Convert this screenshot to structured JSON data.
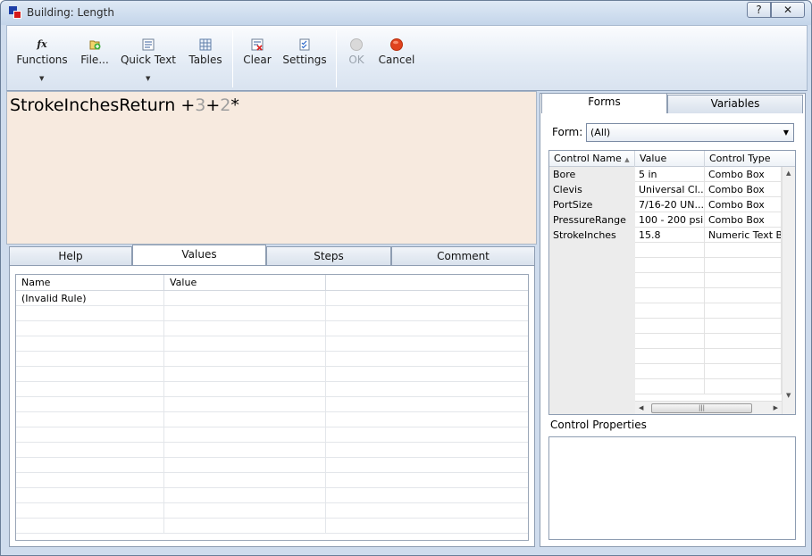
{
  "window": {
    "title": "Building: Length",
    "help_label": "?",
    "close_label": "✕"
  },
  "toolbar": {
    "functions_label": "Functions",
    "file_label": "File...",
    "quicktext_label": "Quick Text",
    "tables_label": "Tables",
    "clear_label": "Clear",
    "settings_label": "Settings",
    "ok_label": "OK",
    "cancel_label": "Cancel",
    "functions_icon": "fx-icon",
    "file_icon": "file-add-icon",
    "quicktext_icon": "text-list-icon",
    "tables_icon": "table-icon",
    "clear_icon": "clear-icon",
    "settings_icon": "settings-checklist-icon",
    "ok_icon": "ok-circle-icon",
    "cancel_icon": "cancel-circle-icon"
  },
  "editor": {
    "text_main": "StrokeInchesReturn +",
    "text_3": "3",
    "text_plus": "+",
    "text_2": "2",
    "text_star": "*"
  },
  "left_tabs": [
    "Help",
    "Values",
    "Steps",
    "Comment"
  ],
  "values_grid": {
    "columns": [
      "Name",
      "Value",
      ""
    ],
    "rows": [
      [
        "(Invalid Rule)",
        "",
        ""
      ]
    ]
  },
  "right_tabs": [
    "Forms",
    "Variables"
  ],
  "form_filter": {
    "label": "Form:",
    "value": "(All)"
  },
  "controls_grid": {
    "columns": [
      "Control Name",
      "Value",
      "Control Type"
    ],
    "sort_indicator": "▲",
    "rows": [
      [
        "Bore",
        "5 in",
        "Combo Box"
      ],
      [
        "Clevis",
        "Universal Cl...",
        "Combo Box"
      ],
      [
        "PortSize",
        "7/16-20 UN...",
        "Combo Box"
      ],
      [
        "PressureRange",
        "100 - 200 psi",
        "Combo Box"
      ],
      [
        "StrokeInches",
        "15.8",
        "Numeric Text Box"
      ]
    ]
  },
  "control_properties": {
    "label": "Control Properties"
  },
  "colors": {
    "editor_bg": "#f7eadf",
    "window_bg": "#cfdced",
    "cancel_red": "#e0421e"
  }
}
